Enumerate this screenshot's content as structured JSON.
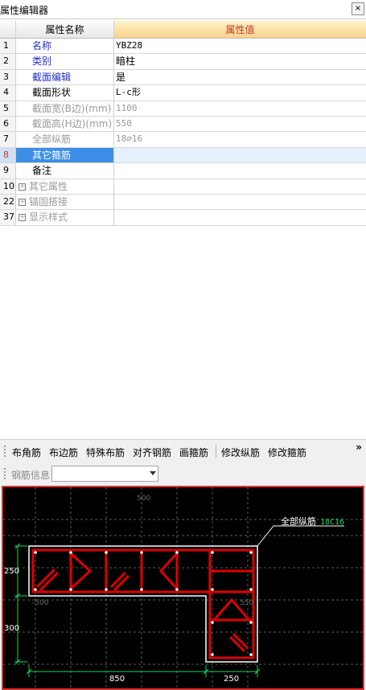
{
  "window": {
    "title": "属性编辑器",
    "pin_icon": "pin-icon",
    "pin_label": "×"
  },
  "grid": {
    "header_name": "属性名称",
    "header_value": "属性值",
    "rows": [
      {
        "num": "1",
        "name": "名称",
        "value": "YBZ28"
      },
      {
        "num": "2",
        "name": "类别",
        "value": "暗柱"
      },
      {
        "num": "3",
        "name": "截面编辑",
        "value": "是"
      },
      {
        "num": "4",
        "name": "截面形状",
        "value": "L-c形"
      },
      {
        "num": "5",
        "name": "截面宽(B边)(mm)",
        "value": "1100"
      },
      {
        "num": "6",
        "name": "截面高(H边)(mm)",
        "value": "550"
      },
      {
        "num": "7",
        "name": "全部纵筋",
        "value": "18⌀16"
      },
      {
        "num": "8",
        "name": "其它箍筋",
        "value": ""
      },
      {
        "num": "9",
        "name": "备注",
        "value": ""
      },
      {
        "num": "10",
        "name": "其它属性",
        "value": ""
      },
      {
        "num": "22",
        "name": "锚固搭接",
        "value": ""
      },
      {
        "num": "37",
        "name": "显示样式",
        "value": ""
      }
    ]
  },
  "toolbar": {
    "items": [
      "布角筋",
      "布边筋",
      "特殊布筋",
      "对齐钢筋",
      "画箍筋",
      "修改纵筋",
      "修改箍筋"
    ],
    "more": "»"
  },
  "infobar": {
    "label": "钢筋信息",
    "selected": ""
  },
  "drawing": {
    "annotation_label": "全部纵筋",
    "annotation_value": "18C16",
    "dim_top": "500",
    "dim_left_a": "-500",
    "dim_right_a": "550",
    "dim_250": "250",
    "dim_300": "300",
    "dim_850": "850",
    "dim_250_bottom": "250",
    "colors": {
      "rebar": "#e00000",
      "outline": "#ffffff",
      "dim": "#19d85a",
      "grid": "#5a5a5a"
    }
  }
}
